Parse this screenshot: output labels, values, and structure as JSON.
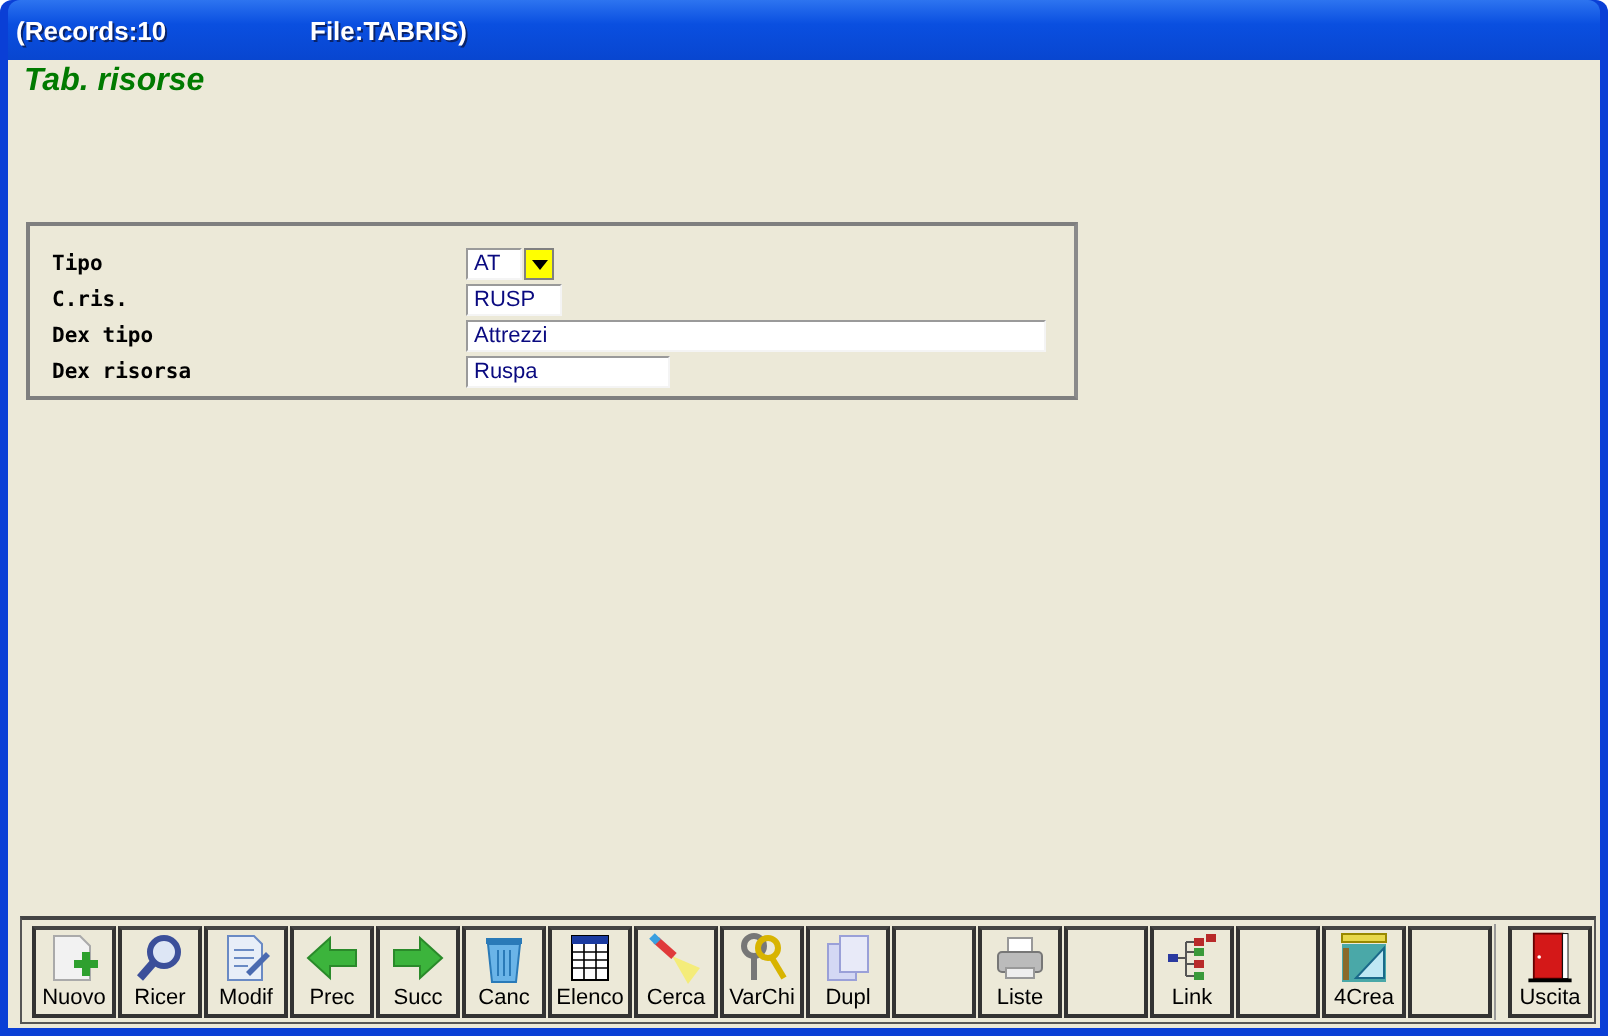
{
  "window": {
    "records": "(Records:10",
    "file": "File:TABRIS)"
  },
  "heading": "Tab. risorse",
  "form": {
    "fields": [
      {
        "label": "Tipo",
        "value": "AT",
        "kind": "combo"
      },
      {
        "label": "C.ris.",
        "value": "RUSP",
        "kind": "text"
      },
      {
        "label": "Dex tipo",
        "value": "Attrezzi",
        "kind": "text"
      },
      {
        "label": "Dex risorsa",
        "value": "Ruspa",
        "kind": "text"
      }
    ]
  },
  "toolbar": {
    "buttons": [
      {
        "label": "Nuovo",
        "kind": "new"
      },
      {
        "label": "Ricer",
        "kind": "search"
      },
      {
        "label": "Modif",
        "kind": "edit"
      },
      {
        "label": "Prec",
        "kind": "prev"
      },
      {
        "label": "Succ",
        "kind": "next"
      },
      {
        "label": "Canc",
        "kind": "delete"
      },
      {
        "label": "Elenco",
        "kind": "table"
      },
      {
        "label": "Cerca",
        "kind": "find"
      },
      {
        "label": "VarChi",
        "kind": "keys"
      },
      {
        "label": "Dupl",
        "kind": "copy"
      },
      {
        "kind": "blank"
      },
      {
        "label": "Liste",
        "kind": "print"
      },
      {
        "kind": "blank"
      },
      {
        "label": "Link",
        "kind": "link"
      },
      {
        "kind": "blank"
      },
      {
        "label": "4Crea",
        "kind": "tools"
      },
      {
        "kind": "blank"
      }
    ],
    "exit_button": {
      "label": "Uscita",
      "kind": "exit"
    }
  }
}
